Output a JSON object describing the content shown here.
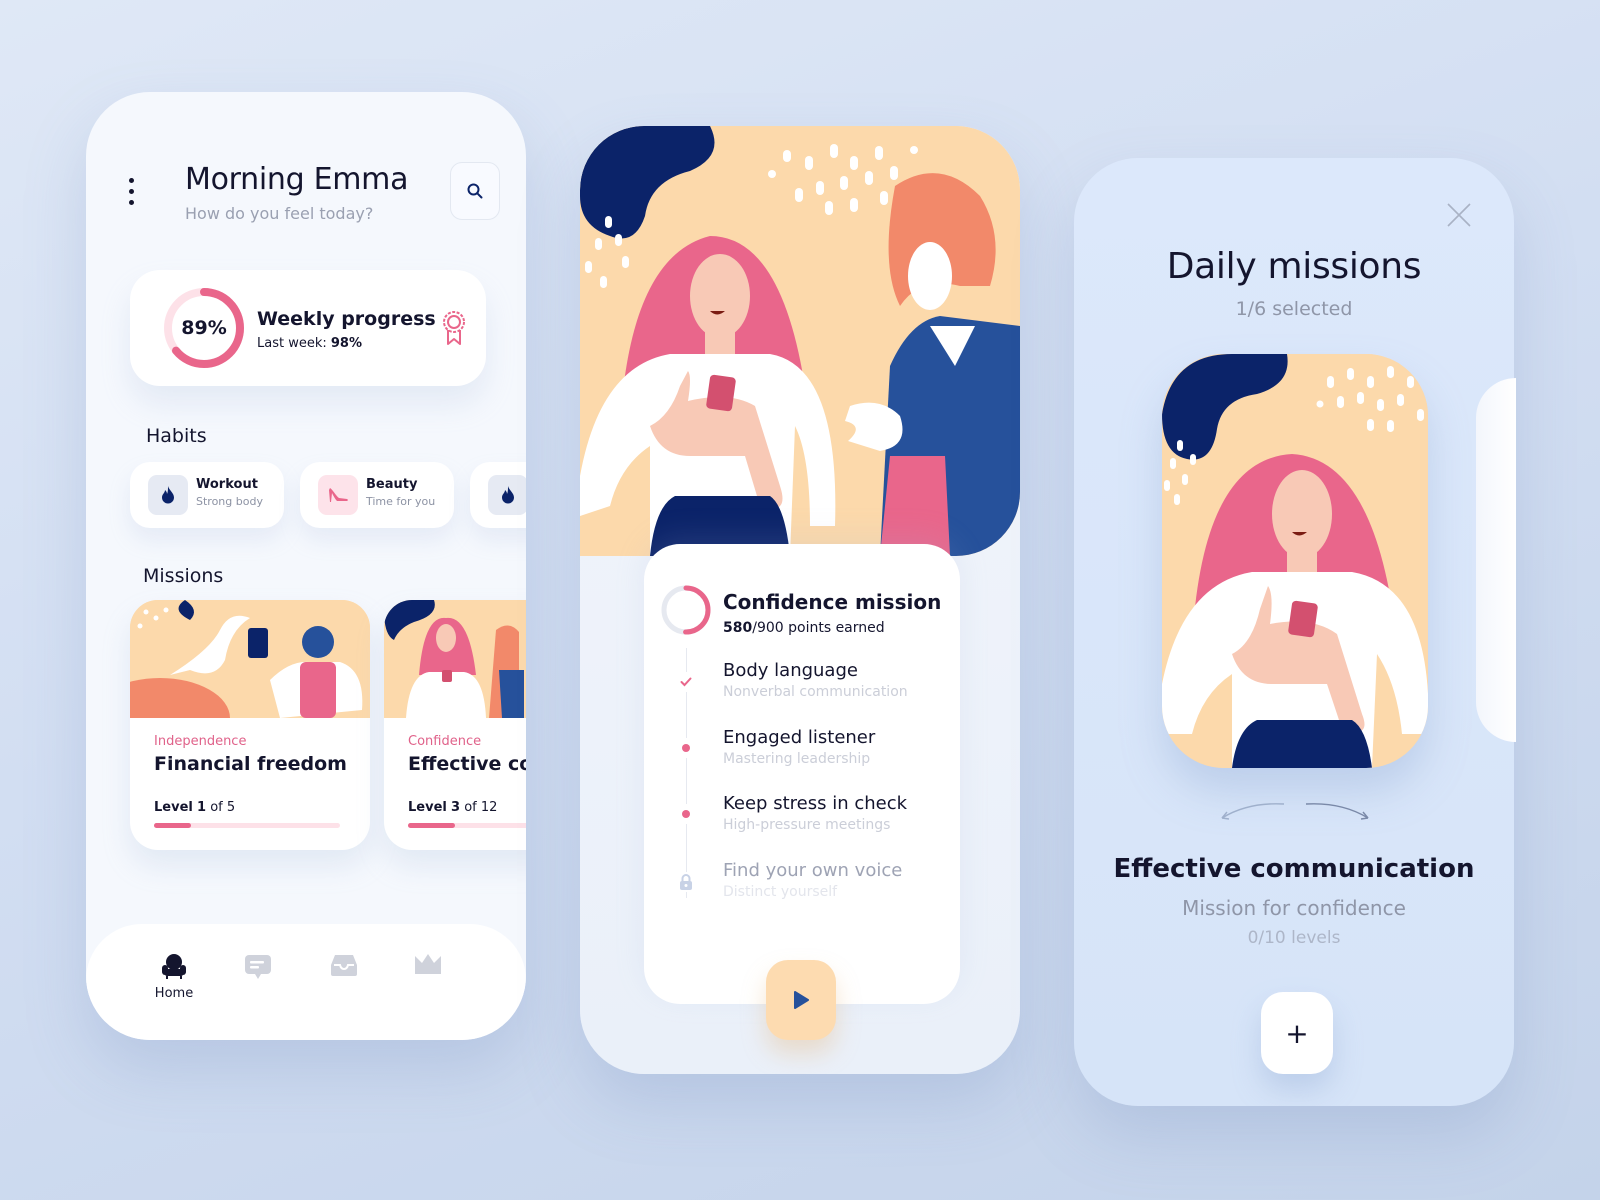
{
  "home": {
    "greeting": "Morning Emma",
    "subtitle": "How do you feel today?",
    "weekly": {
      "percent_label": "89%",
      "progress": 0.89,
      "title": "Weekly progress",
      "last_week_label": "Last week:",
      "last_week_value": "98%"
    },
    "habits_heading": "Habits",
    "habits": [
      {
        "name": "Workout",
        "desc": "Strong body",
        "icon": "flame-icon"
      },
      {
        "name": "Beauty",
        "desc": "Time for you",
        "icon": "high-heel-icon"
      },
      {
        "name": "",
        "desc": "",
        "icon": "flame-icon"
      }
    ],
    "missions_heading": "Missions",
    "missions": [
      {
        "category": "Independence",
        "title": "Financial freedom",
        "level_label": "Level",
        "level": "1",
        "of": "of 5",
        "progress": 0.2
      },
      {
        "category": "Confidence",
        "title": "Effective communication",
        "level_label": "Level",
        "level": "3",
        "of": "of 12",
        "progress": 0.25
      }
    ],
    "nav": [
      {
        "label": "Home",
        "icon": "armchair-icon",
        "active": true
      },
      {
        "label": "",
        "icon": "chat-icon",
        "active": false
      },
      {
        "label": "",
        "icon": "inbox-icon",
        "active": false
      },
      {
        "label": "",
        "icon": "crown-icon",
        "active": false
      }
    ]
  },
  "mission_detail": {
    "title": "Confidence mission",
    "points_earned": "580",
    "points_total": "/900 points earned",
    "progress": 0.644,
    "steps": [
      {
        "title": "Body language",
        "sub": "Nonverbal communication",
        "state": "done"
      },
      {
        "title": "Engaged listener",
        "sub": "Mastering leadership",
        "state": "active"
      },
      {
        "title": "Keep stress in check",
        "sub": "High-pressure meetings",
        "state": "active"
      },
      {
        "title": "Find your own voice",
        "sub": "Distinct yourself",
        "state": "locked"
      }
    ]
  },
  "daily": {
    "title": "Daily missions",
    "selected": "1/6 selected",
    "mission_title": "Effective communication",
    "mission_sub": "Mission for confidence",
    "levels": "0/10 levels",
    "add_label": "+"
  },
  "colors": {
    "accent_pink": "#e9668b",
    "navy": "#0b2369",
    "peach": "#fcd9ab",
    "text": "#14152e"
  }
}
